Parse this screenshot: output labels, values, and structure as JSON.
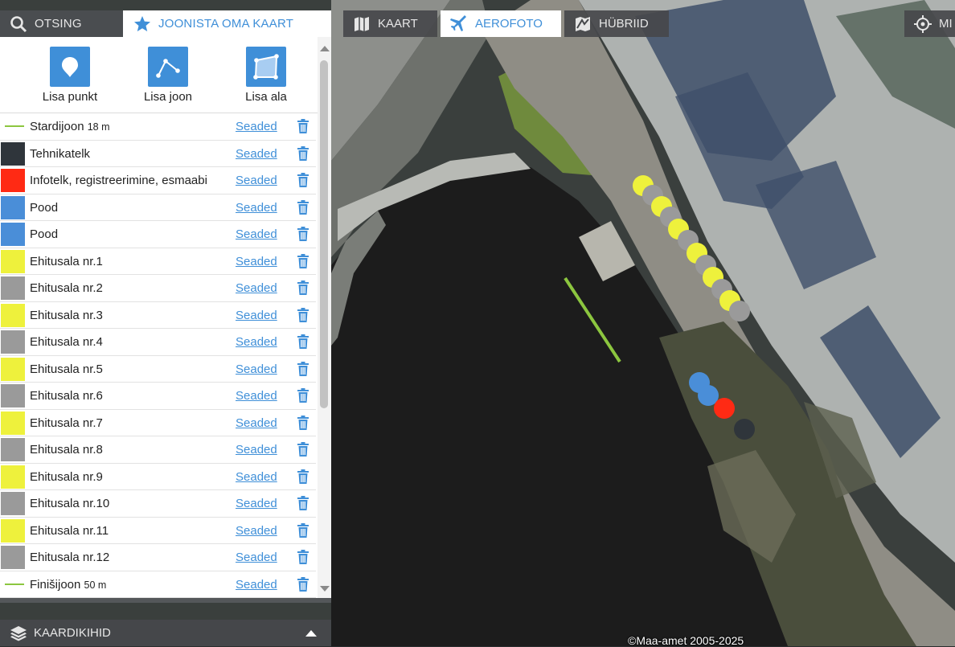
{
  "tabs": {
    "search": "OTSING",
    "draw": "JOONISTA OMA KAART"
  },
  "map_types": {
    "map": "KAART",
    "aerial": "AEROFOTO",
    "hybrid": "HÜBRIID",
    "partial": "MI"
  },
  "tools": {
    "point": "Lisa punkt",
    "line": "Lisa joon",
    "area": "Lisa ala"
  },
  "settings_label": "Seaded",
  "layers": [
    {
      "name": "Stardijoon",
      "measure": "18 m",
      "type": "line",
      "color": "#8cc63f"
    },
    {
      "name": "Tehnikatelk",
      "type": "point",
      "color": "#2f353b"
    },
    {
      "name": "Infotelk, registreerimine, esmaabi",
      "type": "point",
      "color": "#ff2a14"
    },
    {
      "name": "Pood",
      "type": "point",
      "color": "#4a8ed8"
    },
    {
      "name": "Pood",
      "type": "point",
      "color": "#4a8ed8"
    },
    {
      "name": "Ehitusala nr.1",
      "type": "point",
      "color": "#eef13c"
    },
    {
      "name": "Ehitusala nr.2",
      "type": "point",
      "color": "#9a9a9a"
    },
    {
      "name": "Ehitusala nr.3",
      "type": "point",
      "color": "#eef13c"
    },
    {
      "name": "Ehitusala nr.4",
      "type": "point",
      "color": "#9a9a9a"
    },
    {
      "name": "Ehitusala nr.5",
      "type": "point",
      "color": "#eef13c"
    },
    {
      "name": "Ehitusala nr.6",
      "type": "point",
      "color": "#9a9a9a"
    },
    {
      "name": "Ehitusala nr.7",
      "type": "point",
      "color": "#eef13c"
    },
    {
      "name": "Ehitusala nr.8",
      "type": "point",
      "color": "#9a9a9a"
    },
    {
      "name": "Ehitusala nr.9",
      "type": "point",
      "color": "#eef13c"
    },
    {
      "name": "Ehitusala nr.10",
      "type": "point",
      "color": "#9a9a9a"
    },
    {
      "name": "Ehitusala nr.11",
      "type": "point",
      "color": "#eef13c"
    },
    {
      "name": "Ehitusala nr.12",
      "type": "point",
      "color": "#9a9a9a"
    },
    {
      "name": "Finišijoon",
      "measure": "50 m",
      "type": "line",
      "color": "#8cc63f"
    }
  ],
  "bottom": {
    "layers_label": "KAARDIKIHID"
  },
  "copyright": "©Maa-amet 2005-2025",
  "colors": {
    "accent": "#3f8fd8",
    "yellow": "#eef13c",
    "gray": "#9a9a9a",
    "blue": "#4a8ed8",
    "red": "#ff2a14",
    "dark": "#2f353b",
    "line": "#8cc63f"
  }
}
